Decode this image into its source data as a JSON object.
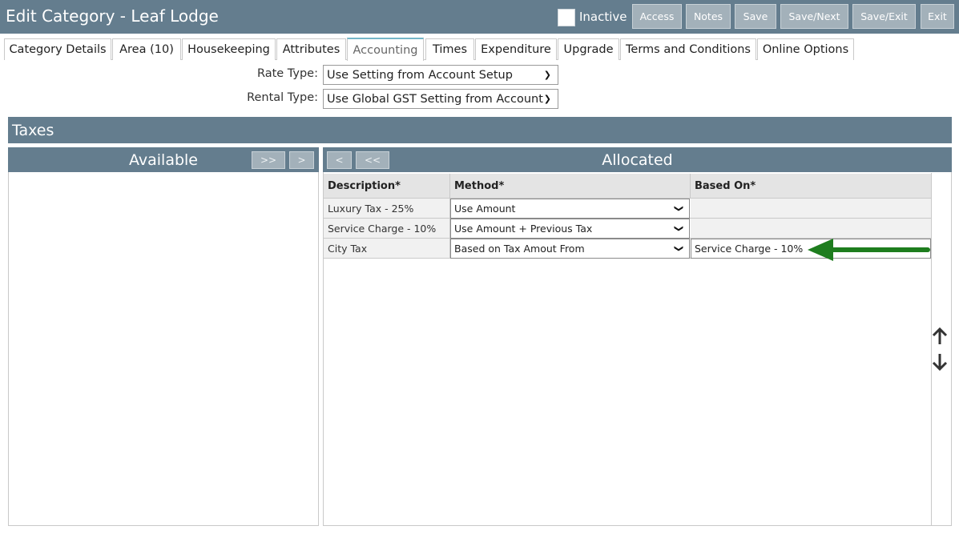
{
  "header": {
    "title": "Edit Category - Leaf Lodge",
    "inactive_label": "Inactive",
    "inactive_checked": false,
    "buttons": [
      "Access",
      "Notes",
      "Save",
      "Save/Next",
      "Save/Exit",
      "Exit"
    ]
  },
  "tabs": [
    {
      "label": "Category Details",
      "active": false
    },
    {
      "label": "Area (10)",
      "active": false
    },
    {
      "label": "Housekeeping",
      "active": false
    },
    {
      "label": "Attributes",
      "active": false
    },
    {
      "label": "Accounting",
      "active": true
    },
    {
      "label": "Times",
      "active": false
    },
    {
      "label": "Expenditure",
      "active": false
    },
    {
      "label": "Upgrade",
      "active": false
    },
    {
      "label": "Terms and Conditions",
      "active": false
    },
    {
      "label": "Online Options",
      "active": false
    }
  ],
  "form": {
    "rate_type_label": "Rate Type:",
    "rate_type_value": "Use Setting from Account Setup",
    "rental_type_label": "Rental Type:",
    "rental_type_value": "Use Global GST Setting from Account"
  },
  "taxes": {
    "section_title": "Taxes",
    "available_title": "Available",
    "allocated_title": "Allocated",
    "available_buttons": [
      ">>",
      ">"
    ],
    "allocated_buttons": [
      "<",
      "<<"
    ],
    "columns": {
      "description": "Description*",
      "method": "Method*",
      "based_on": "Based On*"
    },
    "rows": [
      {
        "description": "Luxury Tax - 25%",
        "method": "Use Amount",
        "based_on": ""
      },
      {
        "description": "Service Charge - 10%",
        "method": "Use Amount + Previous Tax",
        "based_on": ""
      },
      {
        "description": "City Tax",
        "method": "Based on Tax Amout From",
        "based_on": "Service Charge - 10%"
      }
    ]
  },
  "colors": {
    "header_bg": "#647d8e",
    "button_bg": "#a3b1ba",
    "active_tab_accent": "#74b6c8",
    "arrow_annotation": "#1e7d1e"
  },
  "icons": {
    "move_up": "arrow-up-icon",
    "move_down": "arrow-down-icon",
    "annotation": "green-arrow-icon"
  }
}
